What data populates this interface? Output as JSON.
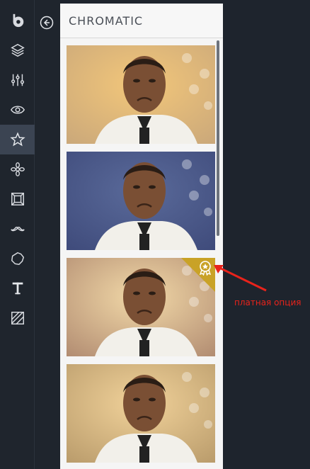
{
  "panel": {
    "title": "CHROMATIC"
  },
  "thumbnails": [
    {
      "name": "filter-1",
      "tint": "#f3c77a",
      "bg": "#c9a77a",
      "premium": false
    },
    {
      "name": "filter-2",
      "tint": "#5a6a9a",
      "bg": "#3e4a7a",
      "premium": false
    },
    {
      "name": "filter-3",
      "tint": "#f2d9a8",
      "bg": "#b08a70",
      "premium": true
    },
    {
      "name": "filter-4",
      "tint": "#f1d29a",
      "bg": "#b89a6a",
      "premium": false
    }
  ],
  "annotation": {
    "text": "платная опция"
  },
  "colors": {
    "accent_premium": "#c9a227",
    "annotation": "#e8231b"
  }
}
